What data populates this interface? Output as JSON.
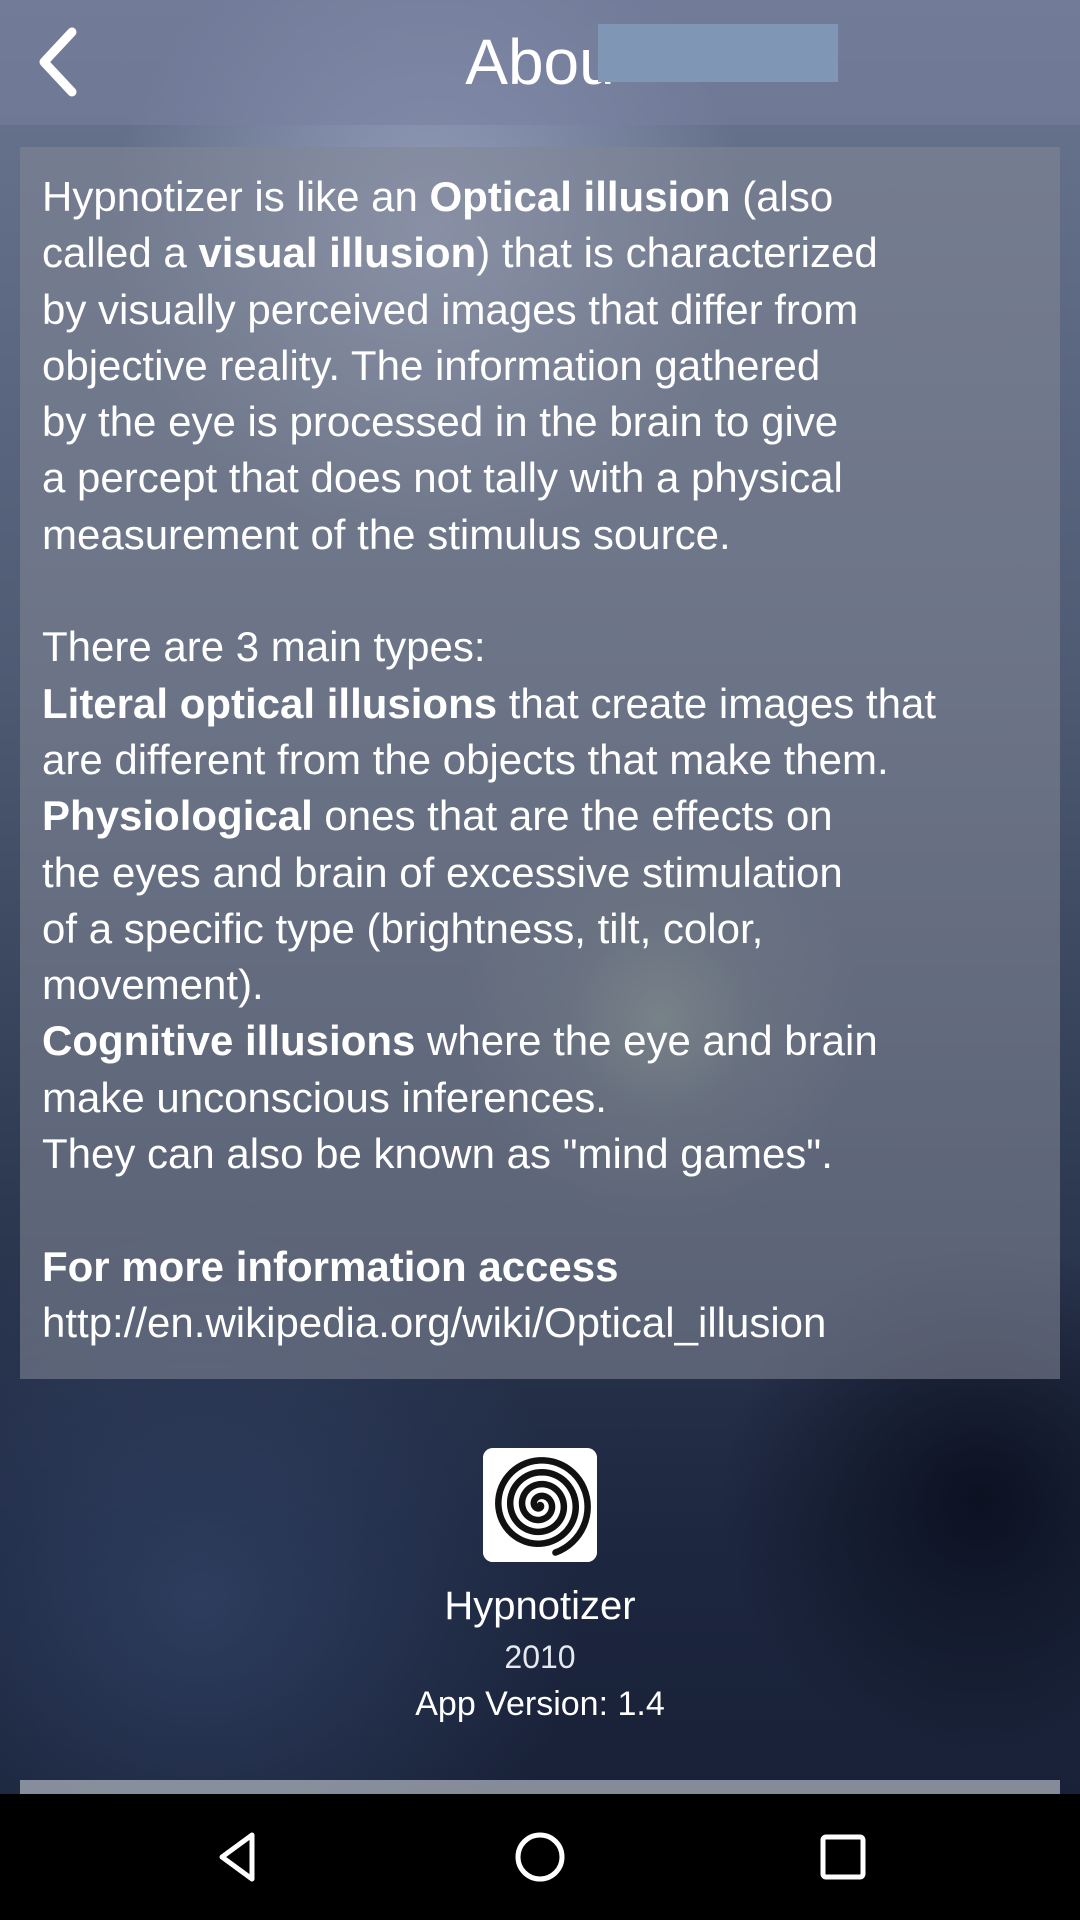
{
  "header": {
    "title": "Abou"
  },
  "about": {
    "p1": [
      {
        "text": "Hypnotizer is like an "
      },
      {
        "bold": "Optical illusion"
      },
      {
        "text": " (also"
      }
    ],
    "lines": {
      "l1a": "Hypnotizer is like an ",
      "l1b": "Optical illusion",
      "l1c": " (also",
      "l2a": "called a ",
      "l2b": "visual illusion",
      "l2c": ") that is characterized",
      "l3": "by visually perceived images that differ from",
      "l4": "objective reality. The information gathered",
      "l5": "by the eye is processed in the brain to give",
      "l6": "a percept that does not tally with a physical",
      "l7": "measurement of the stimulus source.",
      "l9": "There are 3 main types:",
      "l10a": "Literal optical illusions",
      "l10b": " that create images that",
      "l11": "are different from the objects that make them.",
      "l12a": "Physiological",
      "l12b": " ones that are the effects on",
      "l13": "the eyes and brain of excessive stimulation",
      "l14": "of a specific type (brightness, tilt, color,",
      "l15": "movement).",
      "l16a": "Cognitive illusions",
      "l16b": " where the eye and brain",
      "l17": "make unconscious inferences.",
      "l18": "They can also be known as \"mind games\".",
      "l20": "For more information access",
      "l21": "http://en.wikipedia.org/wiki/Optical_illusion"
    }
  },
  "app": {
    "icon": "spiral-icon",
    "name": "Hypnotizer",
    "year": "2010",
    "version": "App Version: 1.4"
  },
  "navbar": {
    "back": "back-triangle-icon",
    "home": "home-circle-icon",
    "recents": "recents-square-icon"
  }
}
